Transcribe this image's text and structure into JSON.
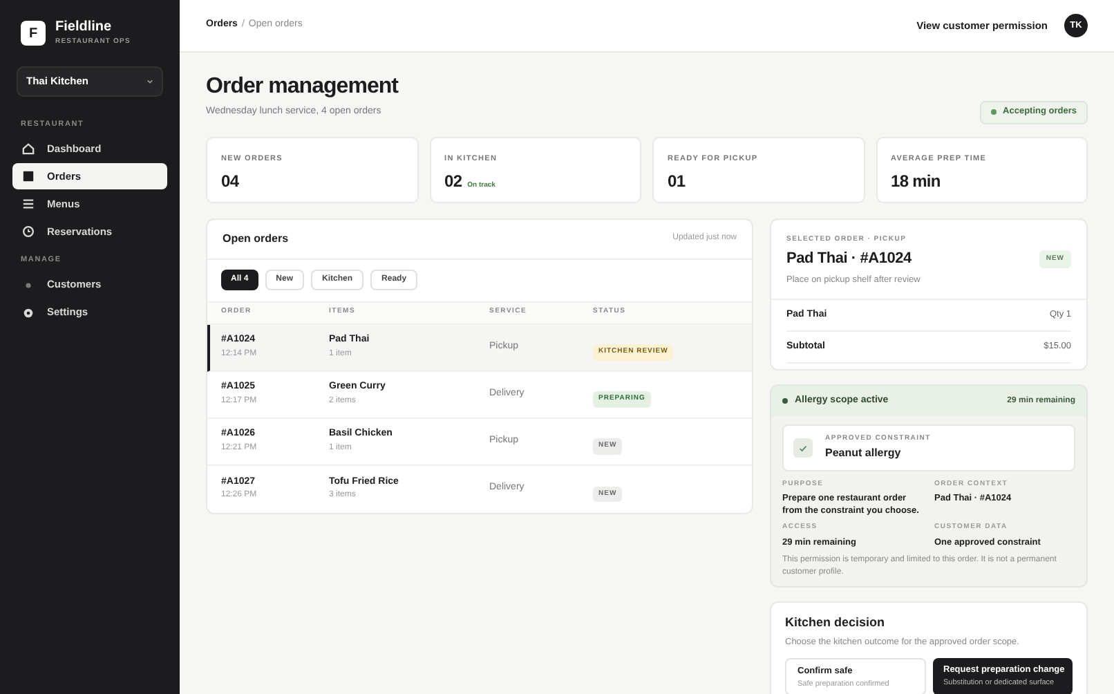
{
  "brand": {
    "logo": "F",
    "name": "Fieldline",
    "tagline": "RESTAURANT OPS"
  },
  "workspace": {
    "value": "Thai Kitchen"
  },
  "sidebar": {
    "sections": [
      {
        "label": "RESTAURANT",
        "items": [
          {
            "label": "Dashboard",
            "kind": "home",
            "selected": false
          },
          {
            "label": "Orders",
            "kind": "square",
            "selected": true
          },
          {
            "label": "Menus",
            "kind": "grid",
            "selected": false
          },
          {
            "label": "Reservations",
            "kind": "clock",
            "selected": false
          }
        ]
      },
      {
        "label": "MANAGE",
        "items": [
          {
            "label": "Customers",
            "kind": "dot",
            "selected": false
          },
          {
            "label": "Settings",
            "kind": "gear",
            "selected": false
          }
        ]
      }
    ]
  },
  "topbar": {
    "breadcrumb": [
      "Orders",
      "Open orders"
    ],
    "breadcrumb_separator": "/",
    "action": "View customer permission",
    "avatar": "TK"
  },
  "header": {
    "title": "Order management",
    "subtitle": "Wednesday lunch service, 4 open orders",
    "status": "Accepting orders"
  },
  "stats": [
    {
      "label": "NEW ORDERS",
      "value": "04"
    },
    {
      "label": "IN KITCHEN",
      "value": "02",
      "note": "On track"
    },
    {
      "label": "READY FOR PICKUP",
      "value": "01"
    },
    {
      "label": "AVERAGE PREP TIME",
      "value": "18 min"
    }
  ],
  "orders": {
    "title": "Open orders",
    "updated": "Updated just now",
    "filters": [
      {
        "label": "All 4",
        "selected": true
      },
      {
        "label": "New",
        "selected": false
      },
      {
        "label": "Kitchen",
        "selected": false
      },
      {
        "label": "Ready",
        "selected": false
      }
    ],
    "columns": [
      "ORDER",
      "ITEMS",
      "SERVICE",
      "STATUS"
    ],
    "rows": [
      {
        "id": "#A1024",
        "time": "12:14 PM",
        "item": "Pad Thai",
        "count": "1 item",
        "service": "Pickup",
        "status": "KITCHEN REVIEW",
        "kind": "review",
        "selected": true
      },
      {
        "id": "#A1025",
        "time": "12:17 PM",
        "item": "Green Curry",
        "count": "2 items",
        "service": "Delivery",
        "status": "PREPARING",
        "kind": "preparing",
        "selected": false
      },
      {
        "id": "#A1026",
        "time": "12:21 PM",
        "item": "Basil Chicken",
        "count": "1 item",
        "service": "Pickup",
        "status": "NEW",
        "kind": "new",
        "selected": false
      },
      {
        "id": "#A1027",
        "time": "12:26 PM",
        "item": "Tofu Fried Rice",
        "count": "3 items",
        "service": "Delivery",
        "status": "NEW",
        "kind": "new",
        "selected": false
      }
    ]
  },
  "selected_order": {
    "eyebrow": "SELECTED ORDER · PICKUP",
    "title": "Pad Thai · #A1024",
    "badge": "NEW",
    "note": "Place on pickup shelf after review",
    "lines": [
      {
        "label": "Pad Thai",
        "value": "Qty 1"
      },
      {
        "label": "Subtotal",
        "value": "$15.00"
      }
    ]
  },
  "allergy": {
    "title": "Allergy scope active",
    "remaining": "29 min remaining",
    "constraint_label": "APPROVED CONSTRAINT",
    "constraint": "Peanut allergy",
    "facts": [
      {
        "label": "PURPOSE",
        "value": "Prepare one restaurant order from the constraint you choose."
      },
      {
        "label": "ORDER CONTEXT",
        "value": "Pad Thai · #A1024"
      },
      {
        "label": "ACCESS",
        "value": "29 min remaining"
      },
      {
        "label": "CUSTOMER DATA",
        "value": "One approved constraint"
      }
    ],
    "footnote": "This permission is temporary and limited to this order. It is not a permanent customer profile."
  },
  "decision": {
    "title": "Kitchen decision",
    "subtitle": "Choose the kitchen outcome for the approved order scope.",
    "options": [
      {
        "label": "Confirm safe",
        "detail": "Safe preparation confirmed",
        "selected": false
      },
      {
        "label": "Request preparation change",
        "detail": "Substitution or dedicated surface",
        "selected": true
      }
    ]
  }
}
